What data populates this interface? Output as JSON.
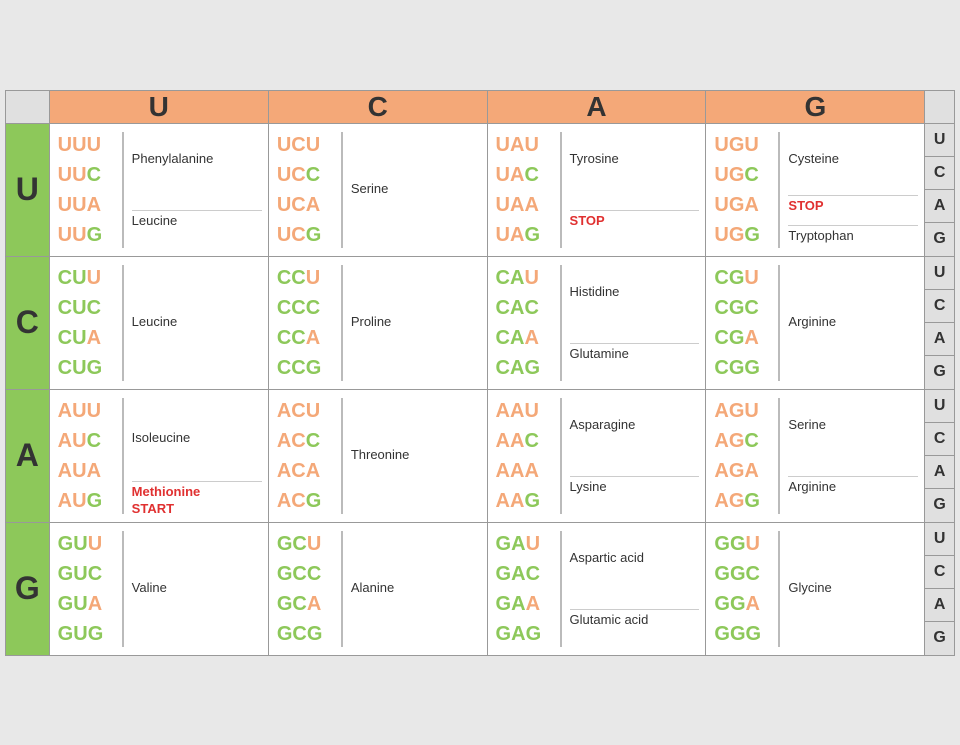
{
  "headers": {
    "columns": [
      "U",
      "C",
      "A",
      "G"
    ],
    "rows": [
      "U",
      "C",
      "A",
      "G"
    ]
  },
  "rightLabels": [
    "U",
    "C",
    "A",
    "G",
    "U",
    "C",
    "A",
    "G",
    "U",
    "C",
    "A",
    "G",
    "U",
    "C",
    "A",
    "G"
  ],
  "table": [
    {
      "rowLabel": "U",
      "cells": [
        {
          "codons": [
            "UUU",
            "UUC",
            "UUA",
            "UUG"
          ],
          "class": "UU",
          "aas": [
            {
              "label": "Phenylalanine",
              "type": "normal",
              "span": 2
            },
            {
              "label": "Leucine",
              "type": "normal",
              "span": 2
            }
          ]
        },
        {
          "codons": [
            "UCU",
            "UCC",
            "UCA",
            "UCG"
          ],
          "class": "UC",
          "aas": [
            {
              "label": "Serine",
              "type": "normal",
              "span": 4
            }
          ]
        },
        {
          "codons": [
            "UAU",
            "UAC",
            "UAA",
            "UAG"
          ],
          "class": "UA",
          "aas": [
            {
              "label": "Tyrosine",
              "type": "normal",
              "span": 2
            },
            {
              "label": "STOP",
              "type": "stop",
              "span": 2
            }
          ]
        },
        {
          "codons": [
            "UGU",
            "UGC",
            "UGA",
            "UGG"
          ],
          "class": "UG",
          "aas": [
            {
              "label": "Cysteine",
              "type": "normal",
              "span": 2
            },
            {
              "label": "STOP",
              "type": "stop",
              "span": 1
            },
            {
              "label": "Tryptophan",
              "type": "normal",
              "span": 1
            }
          ]
        }
      ]
    },
    {
      "rowLabel": "C",
      "cells": [
        {
          "codons": [
            "CUU",
            "CUC",
            "CUA",
            "CUG"
          ],
          "class": "CU",
          "aas": [
            {
              "label": "Leucine",
              "type": "normal",
              "span": 4
            }
          ]
        },
        {
          "codons": [
            "CCU",
            "CCC",
            "CCA",
            "CCG"
          ],
          "class": "CC",
          "aas": [
            {
              "label": "Proline",
              "type": "normal",
              "span": 4
            }
          ]
        },
        {
          "codons": [
            "CAU",
            "CAC",
            "CAA",
            "CAG"
          ],
          "class": "CA",
          "aas": [
            {
              "label": "Histidine",
              "type": "normal",
              "span": 2
            },
            {
              "label": "Glutamine",
              "type": "normal",
              "span": 2
            }
          ]
        },
        {
          "codons": [
            "CGU",
            "CGC",
            "CGA",
            "CGG"
          ],
          "class": "CG",
          "aas": [
            {
              "label": "Arginine",
              "type": "normal",
              "span": 4
            }
          ]
        }
      ]
    },
    {
      "rowLabel": "A",
      "cells": [
        {
          "codons": [
            "AUU",
            "AUC",
            "AUA",
            "AUG"
          ],
          "class": "AU",
          "aas": [
            {
              "label": "Isoleucine",
              "type": "normal",
              "span": 3
            },
            {
              "label": "Methionine START",
              "type": "start",
              "span": 1
            }
          ]
        },
        {
          "codons": [
            "ACU",
            "ACC",
            "ACA",
            "ACG"
          ],
          "class": "AC",
          "aas": [
            {
              "label": "Threonine",
              "type": "normal",
              "span": 4
            }
          ]
        },
        {
          "codons": [
            "AAU",
            "AAC",
            "AAA",
            "AAG"
          ],
          "class": "AA",
          "aas": [
            {
              "label": "Asparagine",
              "type": "normal",
              "span": 2
            },
            {
              "label": "Lysine",
              "type": "normal",
              "span": 2
            }
          ]
        },
        {
          "codons": [
            "AGU",
            "AGC",
            "AGA",
            "AGG"
          ],
          "class": "AG",
          "aas": [
            {
              "label": "Serine",
              "type": "normal",
              "span": 2
            },
            {
              "label": "Arginine",
              "type": "normal",
              "span": 2
            }
          ]
        }
      ]
    },
    {
      "rowLabel": "G",
      "cells": [
        {
          "codons": [
            "GUU",
            "GUC",
            "GUA",
            "GUG"
          ],
          "class": "GU",
          "aas": [
            {
              "label": "Valine",
              "type": "normal",
              "span": 4
            }
          ]
        },
        {
          "codons": [
            "GCU",
            "GCC",
            "GCA",
            "GCG"
          ],
          "class": "GC",
          "aas": [
            {
              "label": "Alanine",
              "type": "normal",
              "span": 4
            }
          ]
        },
        {
          "codons": [
            "GAU",
            "GAC",
            "GAA",
            "GAG"
          ],
          "class": "GA",
          "aas": [
            {
              "label": "Aspartic acid",
              "type": "normal",
              "span": 2
            },
            {
              "label": "Glutamic acid",
              "type": "normal",
              "span": 2
            }
          ]
        },
        {
          "codons": [
            "GGU",
            "GGC",
            "GGA",
            "GGG"
          ],
          "class": "GG",
          "aas": [
            {
              "label": "Glycine",
              "type": "normal",
              "span": 4
            }
          ]
        }
      ]
    }
  ]
}
